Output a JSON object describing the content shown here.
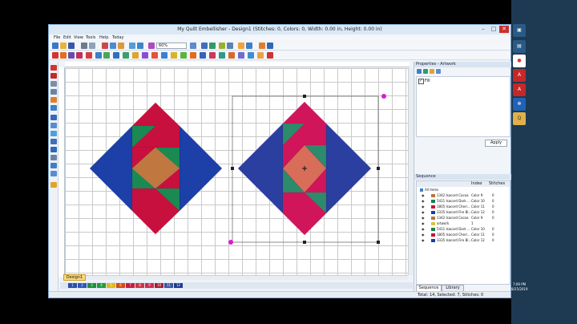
{
  "window": {
    "title": "My Quilt Embellisher - Design1 (Stitches: 0, Colors: 0, Width: 0.00 in, Height: 0.00 in)",
    "min": "–",
    "max": "□",
    "close": "✕"
  },
  "menu": [
    "File",
    "Edit",
    "View",
    "Tools",
    "Help",
    "Today"
  ],
  "toolbar": {
    "zoom": "60%"
  },
  "document_tab": "Design1",
  "color_bar": [
    "1",
    "2",
    "3",
    "4",
    "5",
    "6",
    "7",
    "8",
    "9",
    "10",
    "11",
    "12"
  ],
  "color_bar_colors": [
    "#2a4ea8",
    "#2f55b6",
    "#1e8f3a",
    "#1f9a3f",
    "#e0b81b",
    "#d24c14",
    "#c21f3f",
    "#c93646",
    "#cf2b52",
    "#a91d34",
    "#3d54a0",
    "#1d3b8f"
  ],
  "properties": {
    "title": "Properties - Artwork",
    "fill_label": "Fill",
    "apply": "Apply"
  },
  "sequence": {
    "title": "Sequence",
    "columns": [
      "",
      "Index",
      "Stitches"
    ],
    "root": "All items",
    "rows": [
      {
        "name": "1342 Isacord Cocoa",
        "index": "Color 9",
        "stitches": "0",
        "color": "#b5763f"
      },
      {
        "name": "5411 Isacord Dark ...",
        "index": "Color 10",
        "stitches": "0",
        "color": "#1a7f4a"
      },
      {
        "name": "1805 Isacord Cherr...",
        "index": "Color 11",
        "stitches": "0",
        "color": "#c8143c"
      },
      {
        "name": "3335 Isacord Fire Bl...",
        "index": "Color 12",
        "stitches": "0",
        "color": "#1a3ea0"
      },
      {
        "name": "1342 Isacord Cocoa",
        "index": "Color 9",
        "stitches": "0",
        "color": "#b5763f"
      },
      {
        "name": "artwork",
        "index": "1",
        "stitches": "",
        "color": "#e0c040"
      },
      {
        "name": "5411 Isacord Dark ...",
        "index": "Color 10",
        "stitches": "0",
        "color": "#1a7f4a"
      },
      {
        "name": "1805 Isacord Cherr...",
        "index": "Color 11",
        "stitches": "0",
        "color": "#c8143c"
      },
      {
        "name": "3335 Isacord Fire Bl...",
        "index": "Color 12",
        "stitches": "0",
        "color": "#1a3ea0"
      }
    ],
    "tab_sequence": "Sequence",
    "tab_library": "Library"
  },
  "status": "Total: 14, Selected: 7, Stitches: 0",
  "taskbar": {
    "time": "7:09 PM",
    "date": "8/25/2019"
  },
  "colors": {
    "blue": "#1c3fa8",
    "red": "#c8103e",
    "green": "#1b8a52",
    "tan": "#c07840",
    "blue_stitched": "#2a3fa0",
    "red_stitched": "#d0155a",
    "green_stitched": "#2d8a6a",
    "tan_stitched": "#d86e5a"
  }
}
